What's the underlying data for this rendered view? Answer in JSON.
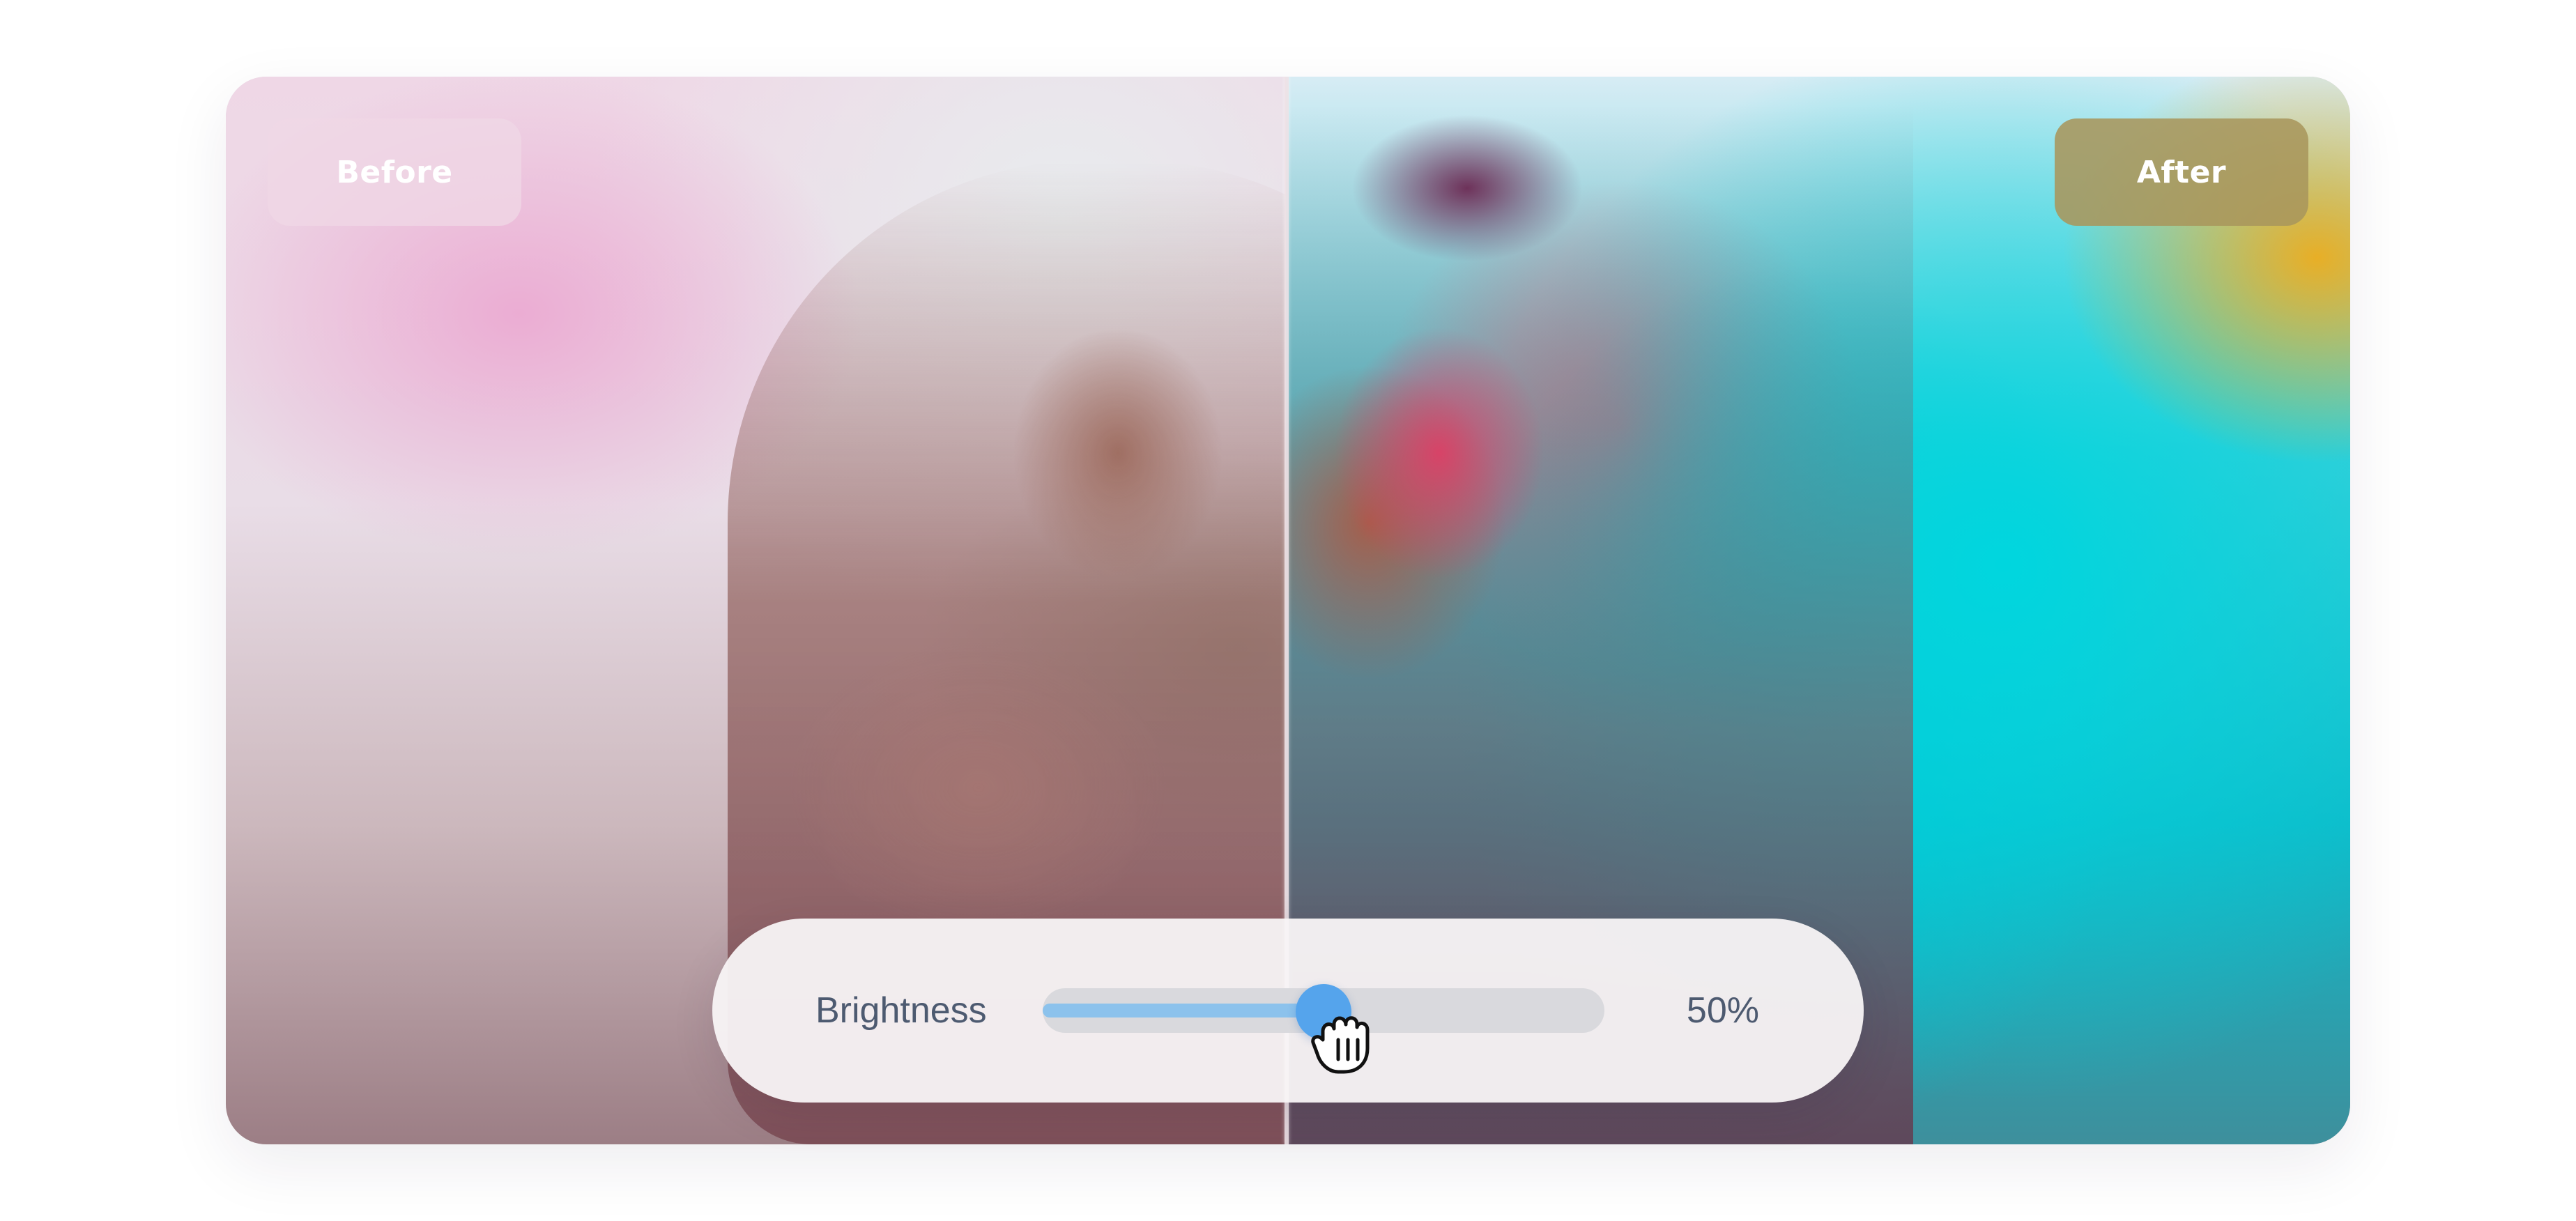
{
  "comparison": {
    "before_label": "Before",
    "after_label": "After",
    "split_fraction": 0.5
  },
  "adjustment": {
    "label": "Brightness",
    "value_text": "50%",
    "value": 0.5
  },
  "colors": {
    "slider_fill": "#8cc2ec",
    "slider_thumb": "#55a4ec",
    "slider_track": "#d9d9dd",
    "label_text": "#4d5a70",
    "after_pill": "#a8965c"
  },
  "icons": {
    "cursor": "grab-hand-icon"
  }
}
